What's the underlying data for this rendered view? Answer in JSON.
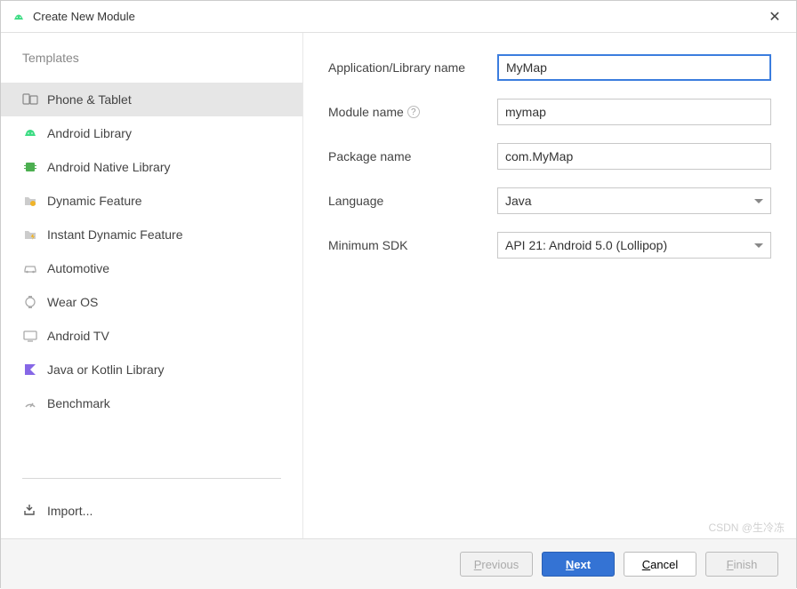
{
  "window": {
    "title": "Create New Module"
  },
  "sidebar": {
    "header": "Templates",
    "items": [
      {
        "label": "Phone & Tablet",
        "icon": "phone-tablet-icon",
        "selected": true
      },
      {
        "label": "Android Library",
        "icon": "android-lib-icon",
        "selected": false
      },
      {
        "label": "Android Native Library",
        "icon": "android-native-icon",
        "selected": false
      },
      {
        "label": "Dynamic Feature",
        "icon": "dynamic-feature-icon",
        "selected": false
      },
      {
        "label": "Instant Dynamic Feature",
        "icon": "instant-dynamic-icon",
        "selected": false
      },
      {
        "label": "Automotive",
        "icon": "automotive-icon",
        "selected": false
      },
      {
        "label": "Wear OS",
        "icon": "wear-os-icon",
        "selected": false
      },
      {
        "label": "Android TV",
        "icon": "android-tv-icon",
        "selected": false
      },
      {
        "label": "Java or Kotlin Library",
        "icon": "kotlin-lib-icon",
        "selected": false
      },
      {
        "label": "Benchmark",
        "icon": "benchmark-icon",
        "selected": false
      }
    ],
    "import_label": "Import..."
  },
  "form": {
    "app_name": {
      "label": "Application/Library name",
      "value": "MyMap"
    },
    "module_name": {
      "label": "Module name",
      "value": "mymap"
    },
    "package_name": {
      "label": "Package name",
      "value": "com.MyMap"
    },
    "language": {
      "label": "Language",
      "value": "Java"
    },
    "min_sdk": {
      "label": "Minimum SDK",
      "value": "API 21: Android 5.0 (Lollipop)"
    }
  },
  "buttons": {
    "previous": "Previous",
    "next": "Next",
    "cancel": "Cancel",
    "finish": "Finish"
  },
  "watermark": "CSDN @生冷冻"
}
